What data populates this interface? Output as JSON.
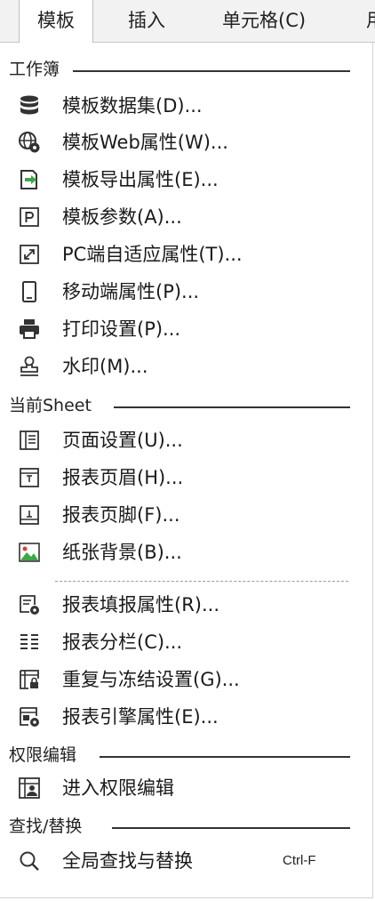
{
  "menubar": {
    "tabs": [
      {
        "label": "模板",
        "active": true
      },
      {
        "label": "插入",
        "active": false
      },
      {
        "label": "单元格(C)",
        "active": false
      },
      {
        "label": "用",
        "active": false
      }
    ]
  },
  "menu": {
    "sections": {
      "workbook": "工作簿",
      "current_sheet": "当前Sheet",
      "permission": "权限编辑",
      "find_replace": "查找/替换"
    },
    "items": {
      "dataset": {
        "label": "模板数据集(D)...",
        "icon": "database-icon"
      },
      "web_props": {
        "label": "模板Web属性(W)...",
        "icon": "globe-gear-icon"
      },
      "export_props": {
        "label": "模板导出属性(E)...",
        "icon": "export-icon"
      },
      "params": {
        "label": "模板参数(A)...",
        "icon": "parameter-icon"
      },
      "pc_adapt": {
        "label": "PC端自适应属性(T)...",
        "icon": "expand-arrows-icon"
      },
      "mobile_props": {
        "label": "移动端属性(P)...",
        "icon": "mobile-icon"
      },
      "print_settings": {
        "label": "打印设置(P)...",
        "icon": "printer-icon"
      },
      "watermark": {
        "label": "水印(M)...",
        "icon": "stamp-icon"
      },
      "page_setup": {
        "label": "页面设置(U)...",
        "icon": "page-setup-icon"
      },
      "header": {
        "label": "报表页眉(H)...",
        "icon": "page-header-icon"
      },
      "footer": {
        "label": "报表页脚(F)...",
        "icon": "page-footer-icon"
      },
      "background": {
        "label": "纸张背景(B)...",
        "icon": "image-icon"
      },
      "fill_props": {
        "label": "报表填报属性(R)...",
        "icon": "form-settings-icon"
      },
      "columns": {
        "label": "报表分栏(C)...",
        "icon": "columns-icon"
      },
      "freeze": {
        "label": "重复与冻结设置(G)...",
        "icon": "freeze-lock-icon"
      },
      "engine_props": {
        "label": "报表引擎属性(E)...",
        "icon": "engine-settings-icon"
      },
      "enter_permission": {
        "label": "进入权限编辑",
        "icon": "permission-user-icon"
      },
      "global_find": {
        "label": "全局查找与替换",
        "icon": "search-icon",
        "shortcut": "Ctrl-F"
      }
    }
  }
}
